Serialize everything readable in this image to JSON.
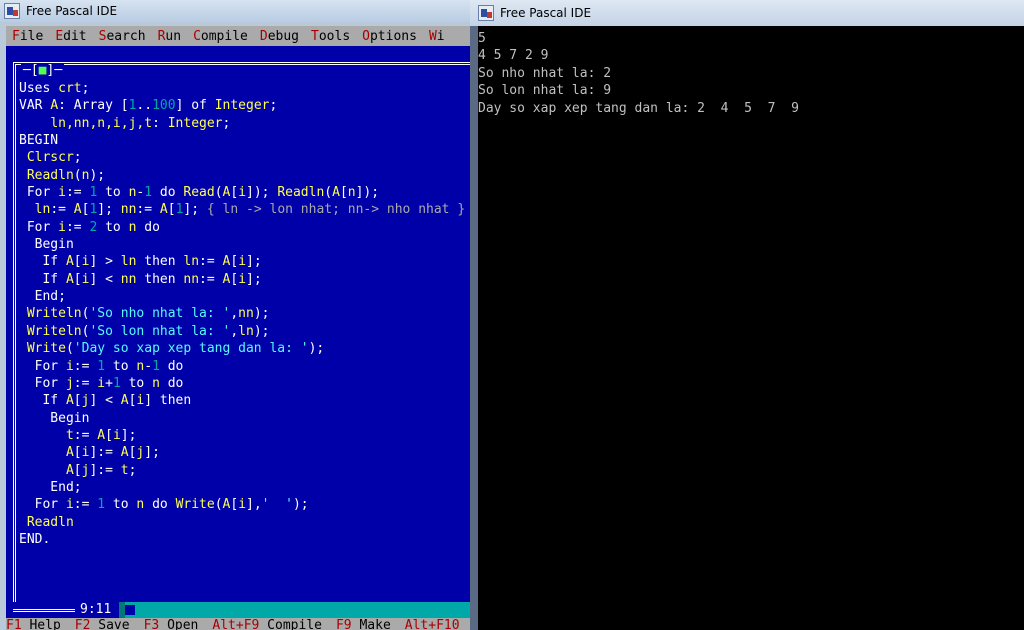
{
  "ide": {
    "title": "Free Pascal IDE",
    "menu": [
      {
        "hot": "F",
        "rest": "ile"
      },
      {
        "hot": "E",
        "rest": "dit"
      },
      {
        "hot": "S",
        "rest": "earch"
      },
      {
        "hot": "R",
        "rest": "un"
      },
      {
        "hot": "C",
        "rest": "ompile"
      },
      {
        "hot": "D",
        "rest": "ebug"
      },
      {
        "hot": "T",
        "rest": "ools"
      },
      {
        "hot": "O",
        "rest": "ptions"
      },
      {
        "hot": "W",
        "rest": "i"
      }
    ],
    "close_box": "[",
    "close_box_dot": "■",
    "close_box_end": "]",
    "cursor_position": "9:11",
    "status_items": [
      {
        "key": "F1",
        "label": "Help"
      },
      {
        "key": "F2",
        "label": "Save"
      },
      {
        "key": "F3",
        "label": "Open"
      },
      {
        "key": "Alt+F9",
        "label": "Compile"
      },
      {
        "key": "F9",
        "label": "Make"
      },
      {
        "key": "Alt+F10",
        "label": ""
      }
    ],
    "code_lines": [
      [
        [
          "kw",
          "Uses "
        ],
        [
          "id",
          "crt"
        ],
        [
          "kw",
          ";"
        ]
      ],
      [
        [
          "kw",
          "VAR "
        ],
        [
          "id",
          "A"
        ],
        [
          "kw",
          ": "
        ],
        [
          "kw",
          "Array "
        ],
        [
          "kw",
          "["
        ],
        [
          "num",
          "1"
        ],
        [
          "kw",
          ".."
        ],
        [
          "num",
          "100"
        ],
        [
          "kw",
          "] "
        ],
        [
          "kw",
          "of "
        ],
        [
          "id",
          "Integer"
        ],
        [
          "kw",
          ";"
        ]
      ],
      [
        [
          "kw",
          "    "
        ],
        [
          "id",
          "ln,nn,n,i,j,t"
        ],
        [
          "kw",
          ": "
        ],
        [
          "id",
          "Integer"
        ],
        [
          "kw",
          ";"
        ]
      ],
      [
        [
          "kw",
          "BEGIN"
        ]
      ],
      [
        [
          "kw",
          " "
        ],
        [
          "id",
          "Clrscr"
        ],
        [
          "kw",
          ";"
        ]
      ],
      [
        [
          "kw",
          " "
        ],
        [
          "id",
          "Readln"
        ],
        [
          "kw",
          "("
        ],
        [
          "id",
          "n"
        ],
        [
          "kw",
          ");"
        ]
      ],
      [
        [
          "kw",
          " For "
        ],
        [
          "id",
          "i"
        ],
        [
          "kw",
          ":= "
        ],
        [
          "num",
          "1"
        ],
        [
          "kw",
          " to "
        ],
        [
          "id",
          "n"
        ],
        [
          "kw",
          "-"
        ],
        [
          "num",
          "1"
        ],
        [
          "kw",
          " do "
        ],
        [
          "id",
          "Read"
        ],
        [
          "kw",
          "("
        ],
        [
          "id",
          "A"
        ],
        [
          "kw",
          "["
        ],
        [
          "id",
          "i"
        ],
        [
          "kw",
          "]); "
        ],
        [
          "id",
          "Readln"
        ],
        [
          "kw",
          "("
        ],
        [
          "id",
          "A"
        ],
        [
          "kw",
          "["
        ],
        [
          "id",
          "n"
        ],
        [
          "kw",
          "]);"
        ]
      ],
      [
        [
          "kw",
          "  "
        ],
        [
          "id",
          "ln"
        ],
        [
          "kw",
          ":= "
        ],
        [
          "id",
          "A"
        ],
        [
          "kw",
          "["
        ],
        [
          "num",
          "1"
        ],
        [
          "kw",
          "]; "
        ],
        [
          "id",
          "nn"
        ],
        [
          "kw",
          ":= "
        ],
        [
          "id",
          "A"
        ],
        [
          "kw",
          "["
        ],
        [
          "num",
          "1"
        ],
        [
          "kw",
          "]; "
        ],
        [
          "cm",
          "{ ln -> lon nhat; nn-> nho nhat }"
        ]
      ],
      [
        [
          "kw",
          " For "
        ],
        [
          "id",
          "i"
        ],
        [
          "kw",
          ":= "
        ],
        [
          "num",
          "2"
        ],
        [
          "kw",
          " to "
        ],
        [
          "id",
          "n"
        ],
        [
          "kw",
          " do"
        ]
      ],
      [
        [
          "kw",
          "  Begin"
        ]
      ],
      [
        [
          "kw",
          "   If "
        ],
        [
          "id",
          "A"
        ],
        [
          "kw",
          "["
        ],
        [
          "id",
          "i"
        ],
        [
          "kw",
          "] > "
        ],
        [
          "id",
          "ln"
        ],
        [
          "kw",
          " then "
        ],
        [
          "id",
          "ln"
        ],
        [
          "kw",
          ":= "
        ],
        [
          "id",
          "A"
        ],
        [
          "kw",
          "["
        ],
        [
          "id",
          "i"
        ],
        [
          "kw",
          "];"
        ]
      ],
      [
        [
          "kw",
          "   If "
        ],
        [
          "id",
          "A"
        ],
        [
          "kw",
          "["
        ],
        [
          "id",
          "i"
        ],
        [
          "kw",
          "] < "
        ],
        [
          "id",
          "nn"
        ],
        [
          "kw",
          " then "
        ],
        [
          "id",
          "nn"
        ],
        [
          "kw",
          ":= "
        ],
        [
          "id",
          "A"
        ],
        [
          "kw",
          "["
        ],
        [
          "id",
          "i"
        ],
        [
          "kw",
          "];"
        ]
      ],
      [
        [
          "kw",
          "  End;"
        ]
      ],
      [
        [
          "kw",
          " "
        ],
        [
          "id",
          "Writeln"
        ],
        [
          "kw",
          "("
        ],
        [
          "str",
          "'So nho nhat la: '"
        ],
        [
          "kw",
          ","
        ],
        [
          "id",
          "nn"
        ],
        [
          "kw",
          ");"
        ]
      ],
      [
        [
          "kw",
          " "
        ],
        [
          "id",
          "Writeln"
        ],
        [
          "kw",
          "("
        ],
        [
          "str",
          "'So lon nhat la: '"
        ],
        [
          "kw",
          ","
        ],
        [
          "id",
          "ln"
        ],
        [
          "kw",
          ");"
        ]
      ],
      [
        [
          "kw",
          " "
        ],
        [
          "id",
          "Write"
        ],
        [
          "kw",
          "("
        ],
        [
          "str",
          "'Day so xap xep tang dan la: '"
        ],
        [
          "kw",
          ");"
        ]
      ],
      [
        [
          "kw",
          "  For "
        ],
        [
          "id",
          "i"
        ],
        [
          "kw",
          ":= "
        ],
        [
          "num",
          "1"
        ],
        [
          "kw",
          " to "
        ],
        [
          "id",
          "n"
        ],
        [
          "kw",
          "-"
        ],
        [
          "num",
          "1"
        ],
        [
          "kw",
          " do"
        ]
      ],
      [
        [
          "kw",
          "  For "
        ],
        [
          "id",
          "j"
        ],
        [
          "kw",
          ":= "
        ],
        [
          "id",
          "i"
        ],
        [
          "kw",
          "+"
        ],
        [
          "num",
          "1"
        ],
        [
          "kw",
          " to "
        ],
        [
          "id",
          "n"
        ],
        [
          "kw",
          " do"
        ]
      ],
      [
        [
          "kw",
          "   If "
        ],
        [
          "id",
          "A"
        ],
        [
          "kw",
          "["
        ],
        [
          "id",
          "j"
        ],
        [
          "kw",
          "] < "
        ],
        [
          "id",
          "A"
        ],
        [
          "kw",
          "["
        ],
        [
          "id",
          "i"
        ],
        [
          "kw",
          "] then"
        ]
      ],
      [
        [
          "kw",
          "    Begin"
        ]
      ],
      [
        [
          "kw",
          "      "
        ],
        [
          "id",
          "t"
        ],
        [
          "kw",
          ":= "
        ],
        [
          "id",
          "A"
        ],
        [
          "kw",
          "["
        ],
        [
          "id",
          "i"
        ],
        [
          "kw",
          "];"
        ]
      ],
      [
        [
          "kw",
          "      "
        ],
        [
          "id",
          "A"
        ],
        [
          "kw",
          "["
        ],
        [
          "id",
          "i"
        ],
        [
          "kw",
          "]:= "
        ],
        [
          "id",
          "A"
        ],
        [
          "kw",
          "["
        ],
        [
          "id",
          "j"
        ],
        [
          "kw",
          "];"
        ]
      ],
      [
        [
          "kw",
          "      "
        ],
        [
          "id",
          "A"
        ],
        [
          "kw",
          "["
        ],
        [
          "id",
          "j"
        ],
        [
          "kw",
          "]:= "
        ],
        [
          "id",
          "t"
        ],
        [
          "kw",
          ";"
        ]
      ],
      [
        [
          "kw",
          "    End;"
        ]
      ],
      [
        [
          "kw",
          "  For "
        ],
        [
          "id",
          "i"
        ],
        [
          "kw",
          ":= "
        ],
        [
          "num",
          "1"
        ],
        [
          "kw",
          " to "
        ],
        [
          "id",
          "n"
        ],
        [
          "kw",
          " do "
        ],
        [
          "id",
          "Write"
        ],
        [
          "kw",
          "("
        ],
        [
          "id",
          "A"
        ],
        [
          "kw",
          "["
        ],
        [
          "id",
          "i"
        ],
        [
          "kw",
          "],"
        ],
        [
          "str",
          "'  '"
        ],
        [
          "kw",
          ");"
        ]
      ],
      [
        [
          "kw",
          " "
        ],
        [
          "id",
          "Readln"
        ]
      ],
      [
        [
          "kw",
          "END."
        ]
      ]
    ]
  },
  "console": {
    "title": "Free Pascal IDE",
    "lines": [
      "5",
      "4 5 7 2 9",
      "So nho nhat la: 2",
      "So lon nhat la: 9",
      "Day so xap xep tang dan la: 2  4  5  7  9"
    ]
  },
  "colors": {
    "editor_bg": "#0000a8",
    "keyword": "#ffffff",
    "identifier": "#ffff54",
    "number": "#00a8a8",
    "string": "#54fcfc",
    "comment": "#aaaaaa",
    "menu_hotkey": "#a80000",
    "console_text": "#c0c0c0"
  }
}
